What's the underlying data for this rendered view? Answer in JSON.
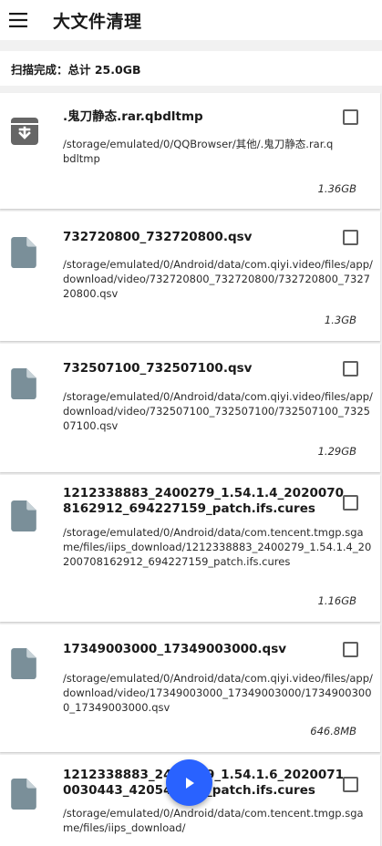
{
  "header": {
    "title": "大文件清理",
    "menu_icon": "menu-icon"
  },
  "summary": {
    "text": "扫描完成：总计 25.0GB"
  },
  "colors": {
    "accent": "#2962ff",
    "file_icon": "#7a8f99",
    "archive_icon": "#666666"
  },
  "files": [
    {
      "name": ".鬼刀静态.rar.qbdltmp",
      "path": "/storage/emulated/0/QQBrowser/其他/.鬼刀静态.rar.qbdltmp",
      "size": "1.36GB",
      "icon": "archive-icon",
      "checked": false
    },
    {
      "name": "732720800_732720800.qsv",
      "path": "/storage/emulated/0/Android/data/com.qiyi.video/files/app/download/video/732720800_732720800/732720800_732720800.qsv",
      "size": "1.3GB",
      "icon": "file-icon",
      "checked": false
    },
    {
      "name": "732507100_732507100.qsv",
      "path": "/storage/emulated/0/Android/data/com.qiyi.video/files/app/download/video/732507100_732507100/732507100_732507100.qsv",
      "size": "1.29GB",
      "icon": "file-icon",
      "checked": false
    },
    {
      "name": "1212338883_2400279_1.54.1.4_20200708162912_694227159_patch.ifs.cures",
      "path": "/storage/emulated/0/Android/data/com.tencent.tmgp.sgame/files/iips_download/1212338883_2400279_1.54.1.4_20200708162912_694227159_patch.ifs.cures",
      "size": "1.16GB",
      "icon": "file-icon",
      "checked": false
    },
    {
      "name": "17349003000_17349003000.qsv",
      "path": "/storage/emulated/0/Android/data/com.qiyi.video/files/app/download/video/17349003000_17349003000/17349003000_17349003000.qsv",
      "size": "646.8MB",
      "icon": "file-icon",
      "checked": false
    },
    {
      "name": "1212338883_2400279_1.54.1.6_20200710030443_420547720_patch.ifs.cures",
      "path": "/storage/emulated/0/Android/data/com.tencent.tmgp.sgame/files/iips_download/",
      "size": "",
      "icon": "file-icon",
      "checked": false
    }
  ],
  "fab": {
    "icon": "play-icon"
  }
}
